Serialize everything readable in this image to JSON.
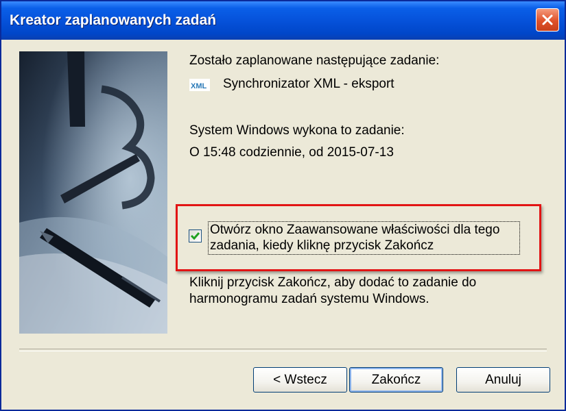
{
  "window": {
    "title": "Kreator zaplanowanych zadań"
  },
  "content": {
    "scheduled_intro": "Zostało zaplanowane następujące zadanie:",
    "task_icon": "xml-file-icon",
    "task_icon_text": "XML",
    "task_name": "Synchronizator XML - eksport",
    "runs_intro": "System Windows wykona to zadanie:",
    "schedule": "O 15:48 codziennie, od 2015-07-13",
    "checkbox": {
      "checked": true,
      "line1": "Otwórz okno Zaawansowane właściwości dla tego",
      "line2": "zadania, kiedy kliknę przycisk Zakończ"
    },
    "footer_line1": "Kliknij przycisk Zakończ, aby dodać to zadanie do",
    "footer_line2": "harmonogramu zadań systemu Windows."
  },
  "buttons": {
    "back": "< Wstecz",
    "finish": "Zakończ",
    "cancel": "Anuluj"
  },
  "colors": {
    "titlebar": "#0550d8",
    "highlight": "#e21414",
    "dialog_bg": "#ece9d8"
  }
}
